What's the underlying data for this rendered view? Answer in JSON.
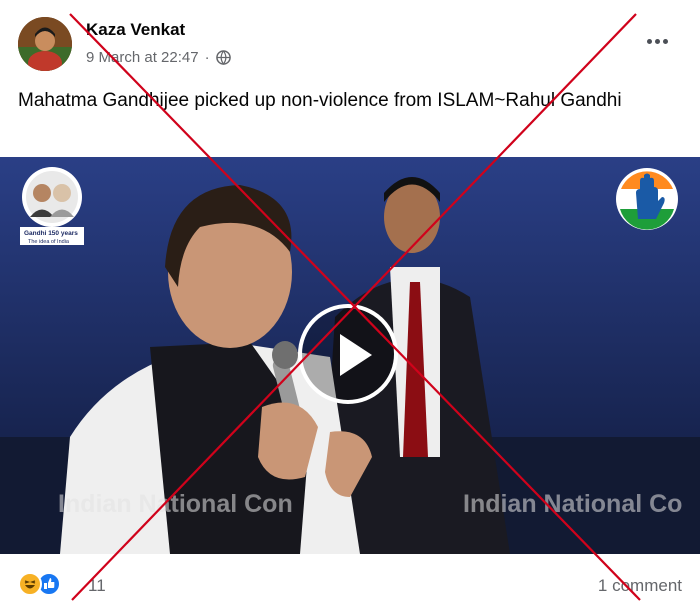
{
  "post": {
    "author": "Kaza Venkat",
    "timestamp": "9 March at 22:47",
    "separator": "·",
    "audience_icon": "globe-icon",
    "menu_icon": "more-options-icon",
    "text": "Mahatma Gandhijee picked up non-violence from ISLAM~Rahul Gandhi"
  },
  "video": {
    "watermark_left": "Indian National Con",
    "watermark_right": "Indian National Co",
    "logo_left_text": "Gandhi 150 years",
    "logo_left_subtext": "The idea of India",
    "logo_right_icon": "congress-hand-logo",
    "play_icon": "play-button-icon"
  },
  "footer": {
    "reactions": [
      "haha-reaction-icon",
      "like-reaction-icon"
    ],
    "reaction_count": "11",
    "comments_label": "1 comment"
  },
  "overlay": {
    "cross_color": "#d0021b"
  },
  "colors": {
    "text_primary": "#050505",
    "text_secondary": "#65676b",
    "video_bg": "#1d2b63",
    "like_blue": "#1877f2",
    "haha_yellow": "#f7b125"
  }
}
